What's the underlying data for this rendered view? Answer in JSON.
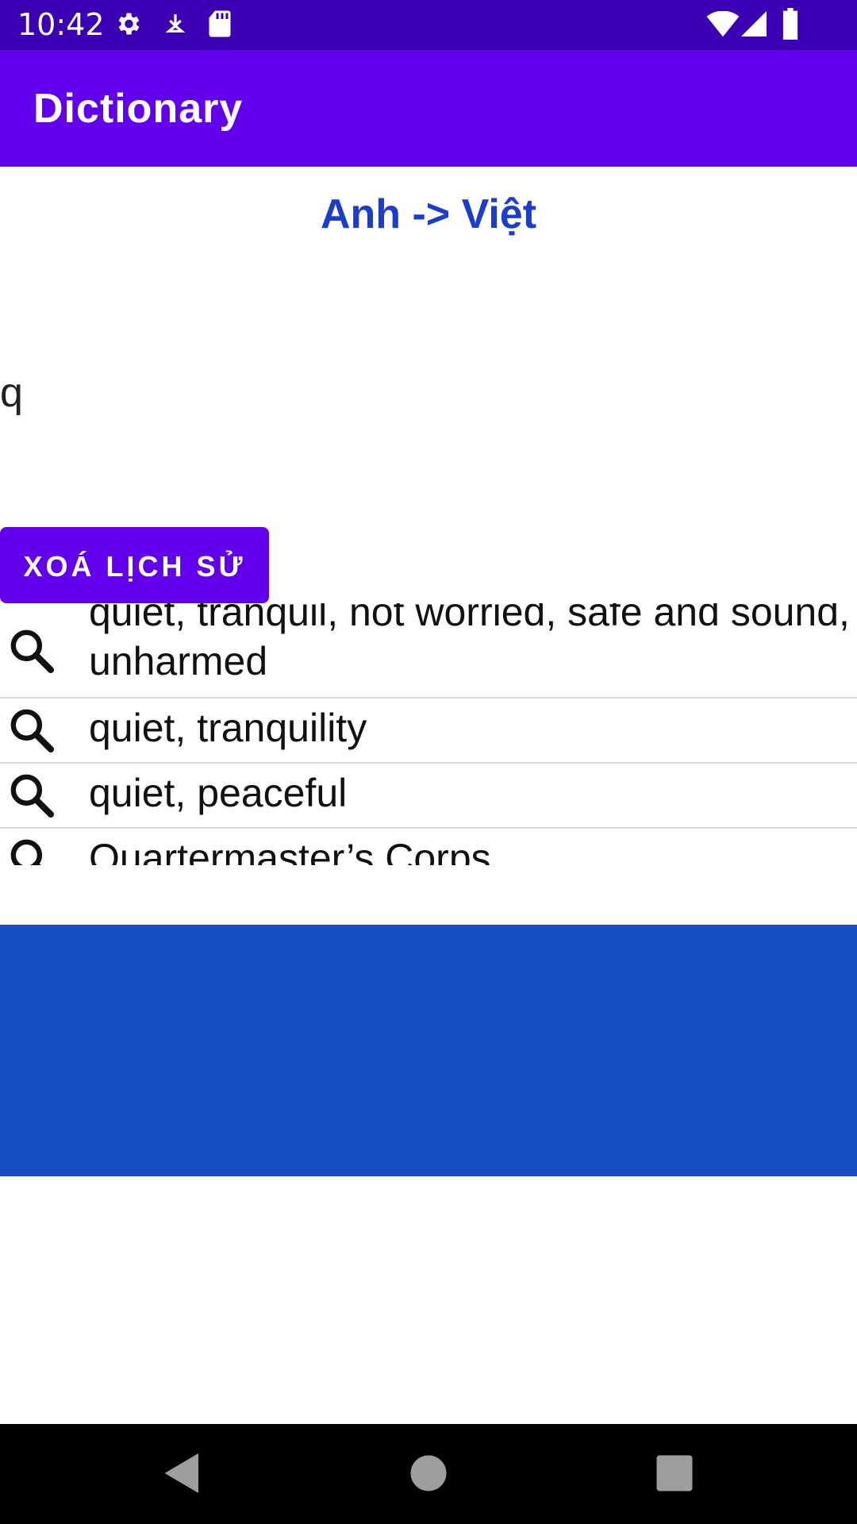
{
  "status_bar": {
    "time": "10:42",
    "icons_left": [
      "gear-icon",
      "download-icon",
      "sd-card-icon"
    ],
    "icons_right": [
      "wifi-icon",
      "signal-icon",
      "battery-icon"
    ],
    "bg_color": "#3b00b3"
  },
  "app_bar": {
    "title": "Dictionary",
    "bg_color": "#6200ee"
  },
  "direction_label": "Anh -> Việt",
  "search": {
    "value": "q"
  },
  "clear_history_button": "XOÁ LỊCH SỬ",
  "history": [
    {
      "line1": "quiet, tranquil, not worried, safe and sound,",
      "line2": "unharmed",
      "icon": "search-icon"
    },
    {
      "line1": "quiet, tranquility",
      "icon": "search-icon"
    },
    {
      "line1": "quiet, peaceful",
      "icon": "search-icon"
    },
    {
      "line1": "Quartermaster’s Corps",
      "icon": "search-icon"
    }
  ],
  "banner_color": "#1450c4",
  "nav": {
    "items": [
      "back-icon",
      "home-icon",
      "recents-icon"
    ]
  }
}
